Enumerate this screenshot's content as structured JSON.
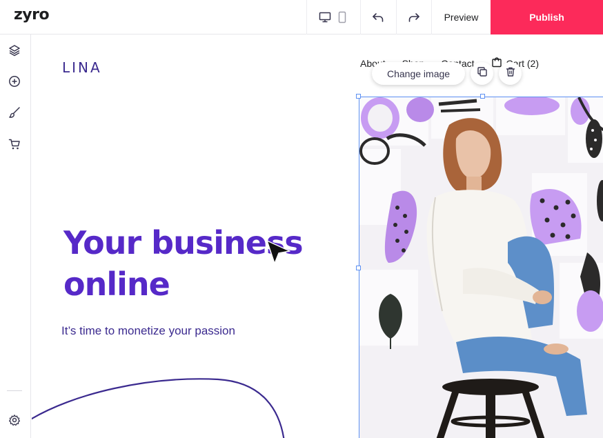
{
  "app": {
    "logo": "zyro",
    "preview_label": "Preview",
    "publish_label": "Publish",
    "colors": {
      "publish": "#fc2a5a",
      "selection": "#5b8ff2",
      "brand_purple": "#5629c8"
    }
  },
  "toolbar_icons": [
    "desktop-icon",
    "mobile-icon",
    "undo-icon",
    "redo-icon"
  ],
  "sidebar_icons": [
    "layers-icon",
    "add-element-icon",
    "brush-icon",
    "cart-icon",
    "settings-icon"
  ],
  "site": {
    "logo": "LINA",
    "nav": {
      "about": "About",
      "shop": "Shop",
      "contact": "Contact",
      "cart": "Cart (2)"
    },
    "hero_title": "Your business online",
    "hero_subtitle": "It’s time to monetize your passion"
  },
  "image_toolbar": {
    "change_image_label": "Change image"
  }
}
